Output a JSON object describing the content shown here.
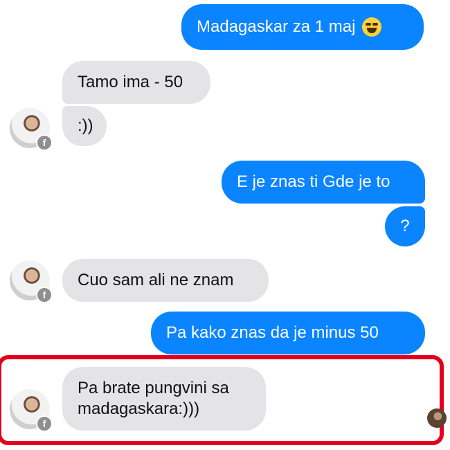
{
  "messages": [
    {
      "side": "out",
      "text": "Madagaskar za 1 maj",
      "emoji": "face-with-tears-of-joy-icon"
    },
    {
      "side": "in",
      "text": "Tamo ima - 50"
    },
    {
      "side": "in",
      "text": ":))"
    },
    {
      "side": "out",
      "text": "E je znas ti Gde je to"
    },
    {
      "side": "out",
      "text": "?"
    },
    {
      "side": "in",
      "text": "Cuo sam ali ne znam"
    },
    {
      "side": "out",
      "text": "Pa kako znas da je minus 50"
    },
    {
      "side": "in",
      "text_lines": [
        "Pa brate pungvini sa",
        "madagaskara:)))"
      ]
    }
  ],
  "avatar_badge": "f",
  "colors": {
    "outgoing_bubble": "#0a84ff",
    "incoming_bubble": "#e4e4e7",
    "highlight_border": "#e3001b"
  }
}
